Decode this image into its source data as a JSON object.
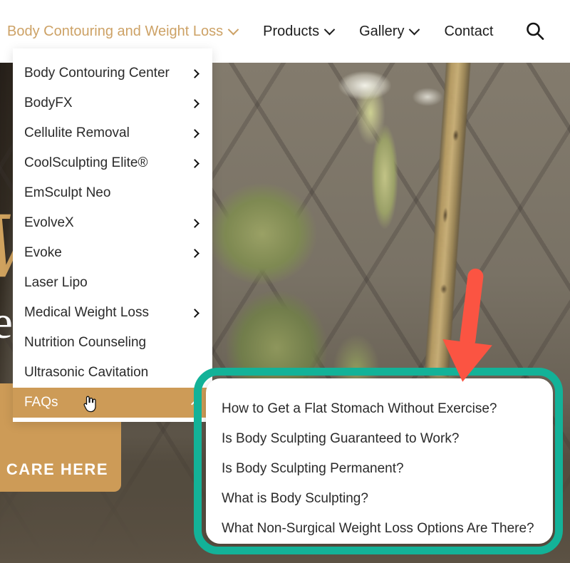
{
  "topnav": {
    "items": [
      {
        "label": "Body Contouring and Weight Loss",
        "has_chevron": true,
        "active": true,
        "icon": "chevron-down-icon"
      },
      {
        "label": "Products",
        "has_chevron": true,
        "active": false,
        "icon": "chevron-down-icon"
      },
      {
        "label": "Gallery",
        "has_chevron": true,
        "active": false,
        "icon": "chevron-down-icon"
      },
      {
        "label": "Contact",
        "has_chevron": false,
        "active": false,
        "icon": ""
      }
    ],
    "search_icon": "search-icon",
    "active_color": "#cda266",
    "text_color": "#1d1d1d"
  },
  "dropdown": {
    "items": [
      {
        "label": "Body Contouring Center",
        "has_submenu": true,
        "icon": "chevron-right-icon",
        "highlighted": false
      },
      {
        "label": "BodyFX",
        "has_submenu": true,
        "icon": "chevron-right-icon",
        "highlighted": false
      },
      {
        "label": "Cellulite Removal",
        "has_submenu": true,
        "icon": "chevron-right-icon",
        "highlighted": false
      },
      {
        "label": "CoolSculpting Elite®",
        "has_submenu": true,
        "icon": "chevron-right-icon",
        "highlighted": false
      },
      {
        "label": "EmSculpt Neo",
        "has_submenu": false,
        "icon": "",
        "highlighted": false
      },
      {
        "label": "EvolveX",
        "has_submenu": true,
        "icon": "chevron-right-icon",
        "highlighted": false
      },
      {
        "label": "Evoke",
        "has_submenu": true,
        "icon": "chevron-right-icon",
        "highlighted": false
      },
      {
        "label": "Laser Lipo",
        "has_submenu": false,
        "icon": "",
        "highlighted": false
      },
      {
        "label": "Medical Weight Loss",
        "has_submenu": true,
        "icon": "chevron-right-icon",
        "highlighted": false
      },
      {
        "label": "Nutrition Counseling",
        "has_submenu": false,
        "icon": "",
        "highlighted": false
      },
      {
        "label": "Ultrasonic Cavitation",
        "has_submenu": false,
        "icon": "",
        "highlighted": false
      },
      {
        "label": "FAQs",
        "has_submenu": true,
        "icon": "chevron-up-icon",
        "highlighted": true
      }
    ],
    "highlight_color": "#cd9b57",
    "highlight_text_color": "#ffffff",
    "background": "#ffffff"
  },
  "submenu": {
    "parent": "FAQs",
    "items": [
      {
        "label": "How to Get a Flat Stomach Without Exercise?"
      },
      {
        "label": "Is Body Sculpting Guaranteed to Work?"
      },
      {
        "label": "Is Body Sculpting Permanent?"
      },
      {
        "label": "What is Body Sculpting?"
      },
      {
        "label": "What Non-Surgical Weight Loss Options Are There?"
      }
    ],
    "background": "#ffffff",
    "text_color": "#2a2a2a"
  },
  "annotations": {
    "callout_box": {
      "color": "#13b298",
      "shape": "rounded-rectangle",
      "target": "FAQs submenu"
    },
    "arrow": {
      "color": "#fb5442",
      "direction": "down",
      "target": "FAQs submenu"
    }
  },
  "hero": {
    "script_text": "Wh",
    "heading_fragment": "ated",
    "cta_label": "CARE HERE",
    "cta_color": "#cd9b57",
    "heading_color": "#ffffff",
    "script_color": "#cfa25e",
    "background_image": "botanical-orchid-photo"
  }
}
